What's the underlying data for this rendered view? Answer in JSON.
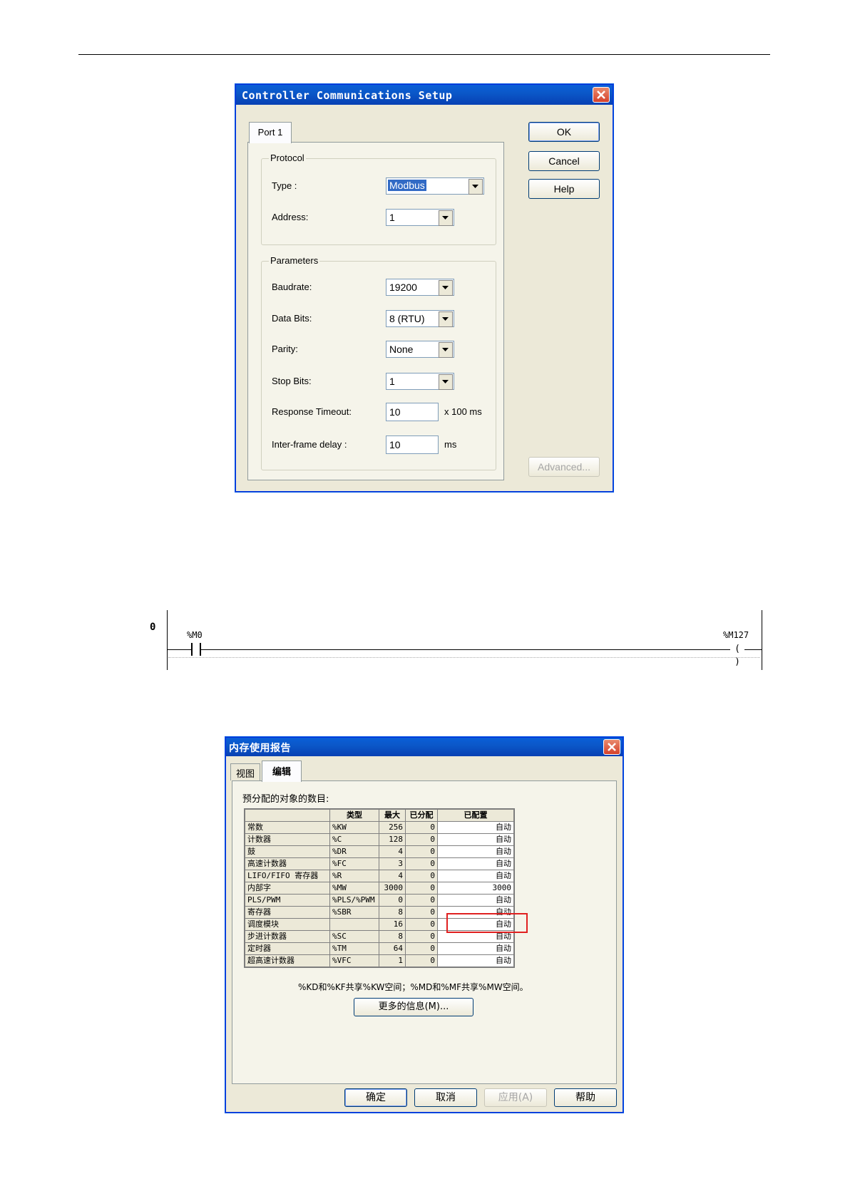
{
  "comm_dialog": {
    "title": "Controller Communications Setup",
    "tab": "Port 1",
    "protocol_group": "Protocol",
    "type_label": "Type :",
    "type_value": "Modbus",
    "address_label": "Address:",
    "address_value": "1",
    "params_group": "Parameters",
    "baudrate_label": "Baudrate:",
    "baudrate_value": "19200",
    "databits_label": "Data Bits:",
    "databits_value": "8 (RTU)",
    "parity_label": "Parity:",
    "parity_value": "None",
    "stopbits_label": "Stop Bits:",
    "stopbits_value": "1",
    "timeout_label": "Response Timeout:",
    "timeout_value": "10",
    "timeout_unit": "x 100 ms",
    "delay_label": "Inter-frame delay :",
    "delay_value": "10",
    "delay_unit": "ms",
    "ok": "OK",
    "cancel": "Cancel",
    "help": "Help",
    "advanced": "Advanced..."
  },
  "ladder": {
    "rung": "0",
    "contact": "%M0",
    "coil": "%M127"
  },
  "mem_dialog": {
    "title": "内存使用报告",
    "tab_view": "视图",
    "tab_edit": "编辑",
    "heading": "预分配的对象的数目:",
    "columns": [
      "",
      "类型",
      "最大",
      "已分配",
      "已配置"
    ],
    "rows": [
      [
        "常数",
        "%KW",
        "256",
        "0",
        "自动"
      ],
      [
        "计数器",
        "%C",
        "128",
        "0",
        "自动"
      ],
      [
        "鼓",
        "%DR",
        "4",
        "0",
        "自动"
      ],
      [
        "高速计数器",
        "%FC",
        "3",
        "0",
        "自动"
      ],
      [
        "LIFO/FIFO 寄存器",
        "%R",
        "4",
        "0",
        "自动"
      ],
      [
        "内部字",
        "%MW",
        "3000",
        "0",
        "3000"
      ],
      [
        "PLS/PWM",
        "%PLS/%PWM",
        "0",
        "0",
        "自动"
      ],
      [
        "寄存器",
        "%SBR",
        "8",
        "0",
        "自动"
      ],
      [
        "调度模块",
        "",
        "16",
        "0",
        "自动"
      ],
      [
        "步进计数器",
        "%SC",
        "8",
        "0",
        "自动"
      ],
      [
        "定时器",
        "%TM",
        "64",
        "0",
        "自动"
      ],
      [
        "超高速计数器",
        "%VFC",
        "1",
        "0",
        "自动"
      ]
    ],
    "note": "%KD和%KF共享%KW空间；%MD和%MF共享%MW空间。",
    "more_info": "更多的信息(M)...",
    "ok": "确定",
    "cancel": "取消",
    "apply": "应用(A)",
    "help": "帮助",
    "highlight_color": "#e02020"
  }
}
